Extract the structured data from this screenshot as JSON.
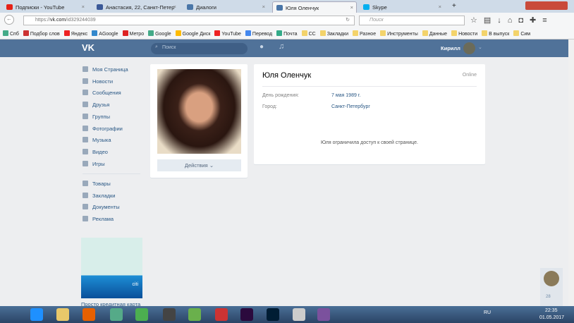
{
  "browser": {
    "tabs": [
      {
        "label": "Подписки - YouTube",
        "color": "#e62117"
      },
      {
        "label": "Анастасия, 22, Санкт-Петер",
        "color": "#3b5998"
      },
      {
        "label": "Диалоги",
        "color": "#4a76a8"
      },
      {
        "label": "Юля Оленчук",
        "color": "#4a76a8"
      },
      {
        "label": "Skype",
        "color": "#00aff0"
      }
    ],
    "new_tab": "+",
    "url_prefix": "https://",
    "url_host": "vk.com",
    "url_path": "/id329244039",
    "search_placeholder": "Поиск",
    "bookmarks": [
      {
        "label": "Спб",
        "color": "#4a8"
      },
      {
        "label": "Подбор слов",
        "color": "#c33"
      },
      {
        "label": "Яндекс",
        "color": "#e22"
      },
      {
        "label": "AGoogle",
        "color": "#38c"
      },
      {
        "label": "Метро",
        "color": "#d22"
      },
      {
        "label": "Google",
        "color": "#4a8"
      },
      {
        "label": "Google Диск",
        "color": "#fb0"
      },
      {
        "label": "YouTube",
        "color": "#e22"
      },
      {
        "label": "Перевод",
        "color": "#48e"
      },
      {
        "label": "Почта",
        "color": "#3a8"
      },
      {
        "label": "CC",
        "color": "#f3d36b"
      },
      {
        "label": "Закладки",
        "color": "#f3d36b"
      },
      {
        "label": "Разное",
        "color": "#f3d36b"
      },
      {
        "label": "Инструменты",
        "color": "#f3d36b"
      },
      {
        "label": "Данные",
        "color": "#f3d36b"
      },
      {
        "label": "Новости",
        "color": "#f3d36b"
      },
      {
        "label": "В выпуск",
        "color": "#f3d36b"
      },
      {
        "label": "Сим",
        "color": "#f3d36b"
      }
    ]
  },
  "vk": {
    "logo": "VK",
    "search_placeholder": "Поиск",
    "user_name": "Кирилл",
    "menu": [
      "Моя Страница",
      "Новости",
      "Сообщения",
      "Друзья",
      "Группы",
      "Фотографии",
      "Музыка",
      "Видео",
      "Игры"
    ],
    "menu2": [
      "Товары",
      "Закладки",
      "Документы",
      "Реклама"
    ],
    "ad_caption": "Просто кредитная карта",
    "ad_brand": "citi",
    "actions_button": "Действия ⌄",
    "profile": {
      "name": "Юля Оленчук",
      "status": "Online",
      "fields": [
        {
          "label": "День рождения:",
          "value": "7 мая 1989 г."
        },
        {
          "label": "Город:",
          "value": "Санкт-Петербург"
        }
      ],
      "restricted": "Юля ограничила доступ к своей странице."
    },
    "chat_count": "28"
  },
  "taskbar": {
    "lang": "RU",
    "time": "22:35",
    "date": "01.05.2017"
  }
}
